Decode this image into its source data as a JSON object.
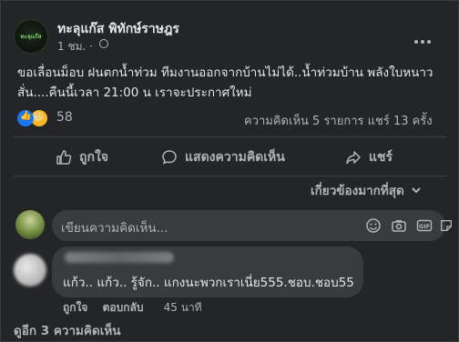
{
  "post": {
    "page_name": "ทะลุแก๊ส พิทักษ์ราษฎร",
    "time": "1 ชม. ·",
    "text": "ขอเลื่อนม็อบ ฝนตกน้ำท่วม ทีมงานออกจากบ้านไม่ได้..น้ำท่วมบ้าน พลังใบหนาวสั่น....คืนนี้เวลา 21:00 น เราจะประกาศใหม่",
    "reaction_count": "58",
    "stats": "ความคิดเห็น 5 รายการ  แชร์ 13 ครั้ง"
  },
  "actions": {
    "like": "ถูกใจ",
    "comment": "แสดงความคิดเห็น",
    "share": "แชร์"
  },
  "sort": {
    "label": "เกี่ยวข้องมากที่สุด"
  },
  "comment_input": {
    "placeholder": "เขียนความคิดเห็น..."
  },
  "comment": {
    "text": "แก้ว.. แก้ว.. รู้จัก.. แกงนะพวกเราเนี่ย555.ชอบ.ชอบ55",
    "like": "ถูกใจ",
    "reply": "ตอบกลับ",
    "time": "45 นาที"
  },
  "more_comments": "ดูอีก 3 ความคิดเห็น",
  "colors": {
    "background": "#242526",
    "bubble": "#3a3b3c",
    "text": "#e4e6eb",
    "secondary": "#b0b3b8",
    "like_blue": "#1877f2"
  }
}
